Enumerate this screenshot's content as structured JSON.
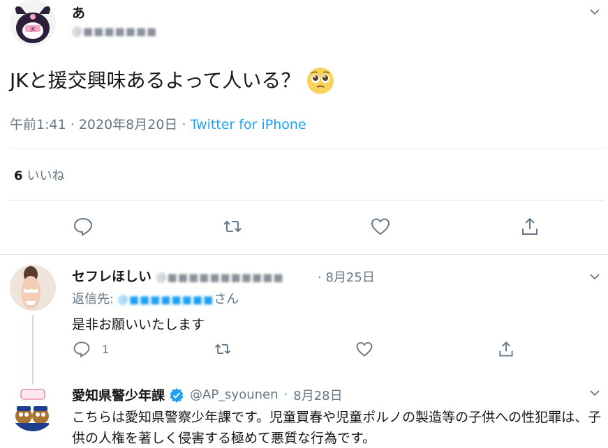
{
  "main_tweet": {
    "display_name": "あ",
    "handle": "@■■■■■■■",
    "text": "JKと援交興味あるよって人いる？",
    "emoji": "pleading-face",
    "time": "午前1:41",
    "date": "2020年8月20日",
    "source": "Twitter for iPhone",
    "like_count": "6",
    "like_label": "いいね"
  },
  "reply_tweet": {
    "display_name": "セフレほしい",
    "handle": "@■■■■■■■■■■■",
    "date": "8月25日",
    "replying_label": "返信先:",
    "replying_to": "@■■■■■■■■",
    "replying_suffix": "さん",
    "text": "是非お願いいたします",
    "reply_count": "1"
  },
  "police_tweet": {
    "display_name": "愛知県警少年課",
    "handle": "@AP_syounen",
    "date": "8月28日",
    "text": "こちらは愛知県警察少年課です。児童買春や児童ポルノの製造等の子供への性犯罪は、子供の人権を著しく侵害する極めて悪質な行為です。"
  },
  "separator": "·",
  "colors": {
    "accent": "#1da1f2",
    "secondary_text": "#657786",
    "divider": "#e6ecf0"
  }
}
